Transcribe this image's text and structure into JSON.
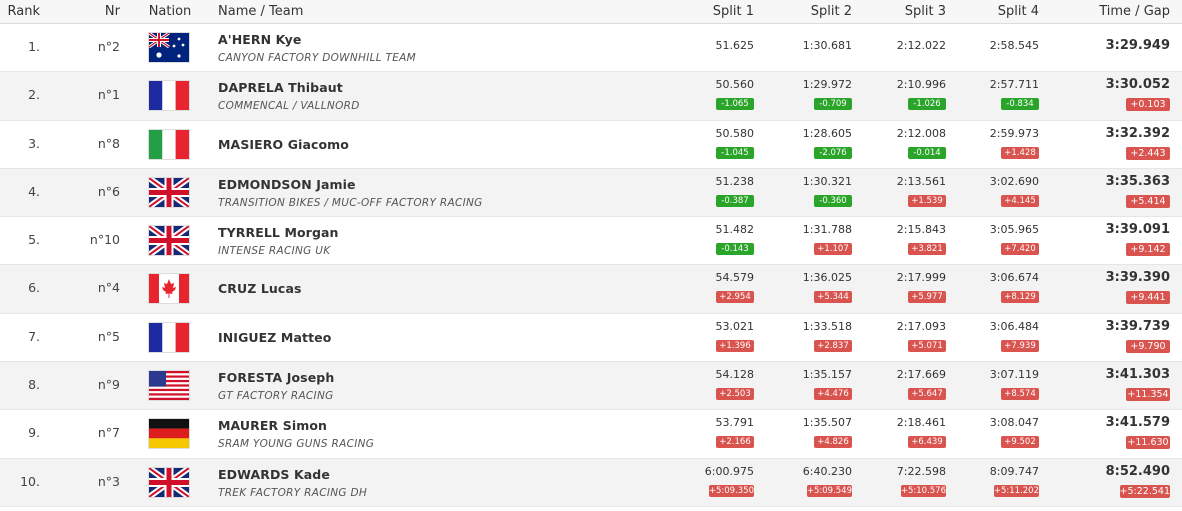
{
  "headers": {
    "rank": "Rank",
    "nr": "Nr",
    "nation": "Nation",
    "name_team": "Name / Team",
    "split1": "Split 1",
    "split2": "Split 2",
    "split3": "Split 3",
    "split4": "Split 4",
    "time_gap": "Time / Gap"
  },
  "colors": {
    "gap_positive": "#d9534f",
    "gap_negative": "#2aa52a",
    "row_alt": "#f3f3f3"
  },
  "rows": [
    {
      "rank": "1.",
      "nr": "n°2",
      "flag": "australia-flag-icon",
      "name": "A'HERN Kye",
      "team": "CANYON FACTORY DOWNHILL TEAM",
      "splits": [
        {
          "t": "51.625",
          "g": ""
        },
        {
          "t": "1:30.681",
          "g": ""
        },
        {
          "t": "2:12.022",
          "g": ""
        },
        {
          "t": "2:58.545",
          "g": ""
        }
      ],
      "time": "3:29.949",
      "gap": ""
    },
    {
      "rank": "2.",
      "nr": "n°1",
      "flag": "france-flag-icon",
      "name": "DAPRELA Thibaut",
      "team": "COMMENCAL / VALLNORD",
      "splits": [
        {
          "t": "50.560",
          "g": "-1.065"
        },
        {
          "t": "1:29.972",
          "g": "-0.709"
        },
        {
          "t": "2:10.996",
          "g": "-1.026"
        },
        {
          "t": "2:57.711",
          "g": "-0.834"
        }
      ],
      "time": "3:30.052",
      "gap": "+0.103"
    },
    {
      "rank": "3.",
      "nr": "n°8",
      "flag": "italy-flag-icon",
      "name": "MASIERO Giacomo",
      "team": "",
      "splits": [
        {
          "t": "50.580",
          "g": "-1.045"
        },
        {
          "t": "1:28.605",
          "g": "-2.076"
        },
        {
          "t": "2:12.008",
          "g": "-0.014"
        },
        {
          "t": "2:59.973",
          "g": "+1.428"
        }
      ],
      "time": "3:32.392",
      "gap": "+2.443"
    },
    {
      "rank": "4.",
      "nr": "n°6",
      "flag": "uk-flag-icon",
      "name": "EDMONDSON Jamie",
      "team": "TRANSITION BIKES / MUC-OFF FACTORY RACING",
      "splits": [
        {
          "t": "51.238",
          "g": "-0.387"
        },
        {
          "t": "1:30.321",
          "g": "-0.360"
        },
        {
          "t": "2:13.561",
          "g": "+1.539"
        },
        {
          "t": "3:02.690",
          "g": "+4.145"
        }
      ],
      "time": "3:35.363",
      "gap": "+5.414"
    },
    {
      "rank": "5.",
      "nr": "n°10",
      "flag": "uk-flag-icon",
      "name": "TYRRELL Morgan",
      "team": "INTENSE RACING UK",
      "splits": [
        {
          "t": "51.482",
          "g": "-0.143"
        },
        {
          "t": "1:31.788",
          "g": "+1.107"
        },
        {
          "t": "2:15.843",
          "g": "+3.821"
        },
        {
          "t": "3:05.965",
          "g": "+7.420"
        }
      ],
      "time": "3:39.091",
      "gap": "+9.142"
    },
    {
      "rank": "6.",
      "nr": "n°4",
      "flag": "canada-flag-icon",
      "name": "CRUZ Lucas",
      "team": "",
      "splits": [
        {
          "t": "54.579",
          "g": "+2.954"
        },
        {
          "t": "1:36.025",
          "g": "+5.344"
        },
        {
          "t": "2:17.999",
          "g": "+5.977"
        },
        {
          "t": "3:06.674",
          "g": "+8.129"
        }
      ],
      "time": "3:39.390",
      "gap": "+9.441"
    },
    {
      "rank": "7.",
      "nr": "n°5",
      "flag": "france-flag-icon",
      "name": "INIGUEZ Matteo",
      "team": "",
      "splits": [
        {
          "t": "53.021",
          "g": "+1.396"
        },
        {
          "t": "1:33.518",
          "g": "+2.837"
        },
        {
          "t": "2:17.093",
          "g": "+5.071"
        },
        {
          "t": "3:06.484",
          "g": "+7.939"
        }
      ],
      "time": "3:39.739",
      "gap": "+9.790"
    },
    {
      "rank": "8.",
      "nr": "n°9",
      "flag": "usa-flag-icon",
      "name": "FORESTA Joseph",
      "team": "GT FACTORY RACING",
      "splits": [
        {
          "t": "54.128",
          "g": "+2.503"
        },
        {
          "t": "1:35.157",
          "g": "+4.476"
        },
        {
          "t": "2:17.669",
          "g": "+5.647"
        },
        {
          "t": "3:07.119",
          "g": "+8.574"
        }
      ],
      "time": "3:41.303",
      "gap": "+11.354"
    },
    {
      "rank": "9.",
      "nr": "n°7",
      "flag": "germany-flag-icon",
      "name": "MAURER Simon",
      "team": "SRAM YOUNG GUNS RACING",
      "splits": [
        {
          "t": "53.791",
          "g": "+2.166"
        },
        {
          "t": "1:35.507",
          "g": "+4.826"
        },
        {
          "t": "2:18.461",
          "g": "+6.439"
        },
        {
          "t": "3:08.047",
          "g": "+9.502"
        }
      ],
      "time": "3:41.579",
      "gap": "+11.630"
    },
    {
      "rank": "10.",
      "nr": "n°3",
      "flag": "uk-flag-icon",
      "name": "EDWARDS Kade",
      "team": "TREK FACTORY RACING DH",
      "splits": [
        {
          "t": "6:00.975",
          "g": "+5:09.350"
        },
        {
          "t": "6:40.230",
          "g": "+5:09.549"
        },
        {
          "t": "7:22.598",
          "g": "+5:10.576"
        },
        {
          "t": "8:09.747",
          "g": "+5:11.202"
        }
      ],
      "time": "8:52.490",
      "gap": "+5:22.541"
    }
  ]
}
